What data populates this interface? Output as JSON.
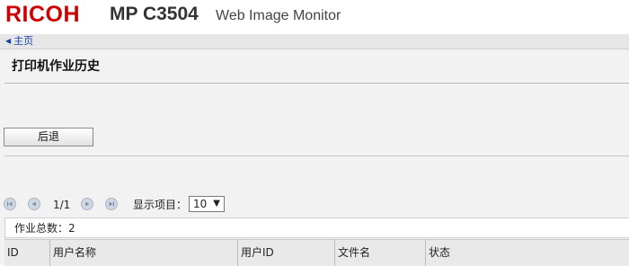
{
  "header": {
    "logo": "RICOH",
    "model": "MP C3504",
    "product": "Web Image Monitor"
  },
  "nav": {
    "home_label": "主页"
  },
  "page": {
    "title": "打印机作业历史",
    "back_label": "后退"
  },
  "pager": {
    "page_text": "1/1",
    "display_label": "显示项目：",
    "display_value": "10",
    "display_caret": "▼"
  },
  "table": {
    "total_text": "作业总数：2",
    "columns": [
      "ID",
      "用户名称",
      "用户ID",
      "文件名",
      "状态"
    ]
  }
}
